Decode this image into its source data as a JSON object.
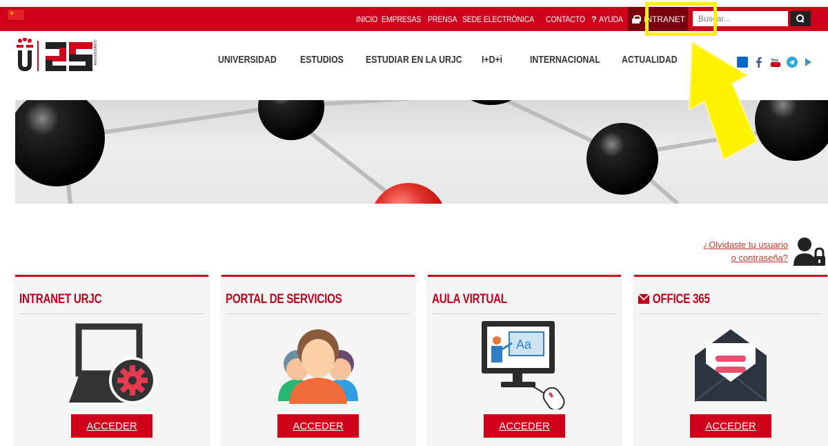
{
  "topbar": {
    "links": [
      "INICIO",
      "EMPRESAS",
      "PRENSA",
      "SEDE ELECTRÓNICA",
      "CONTACTO"
    ],
    "help_label": "AYUDA",
    "intranet_label": "INTRANET",
    "search_placeholder": "Buscar..."
  },
  "nav": {
    "items": [
      "UNIVERSIDAD",
      "ESTUDIOS",
      "ESTUDIAR EN LA URJC",
      "I+D+i",
      "INTERNACIONAL",
      "ACTUALIDAD"
    ]
  },
  "logo": {
    "letter": "ü",
    "numeral": "25",
    "side_text": "ANIVERSARIO"
  },
  "forgot": {
    "line1": "¿Olvidaste tu usuario",
    "line2": "o contraseña?"
  },
  "cards": [
    {
      "title": "INTRANET URJC",
      "button": "ACCEDER",
      "icon": "laptop-gear-icon"
    },
    {
      "title": "PORTAL DE SERVICIOS",
      "button": "ACCEDER",
      "icon": "people-group-icon"
    },
    {
      "title": "AULA VIRTUAL",
      "button": "ACCEDER",
      "icon": "virtual-classroom-icon"
    },
    {
      "title": "OFFICE 365",
      "button": "ACCEDER",
      "icon": "open-envelope-icon"
    }
  ],
  "colors": {
    "brand_red": "#d0021b",
    "dark_red": "#7a0010",
    "highlight": "#fff200"
  }
}
